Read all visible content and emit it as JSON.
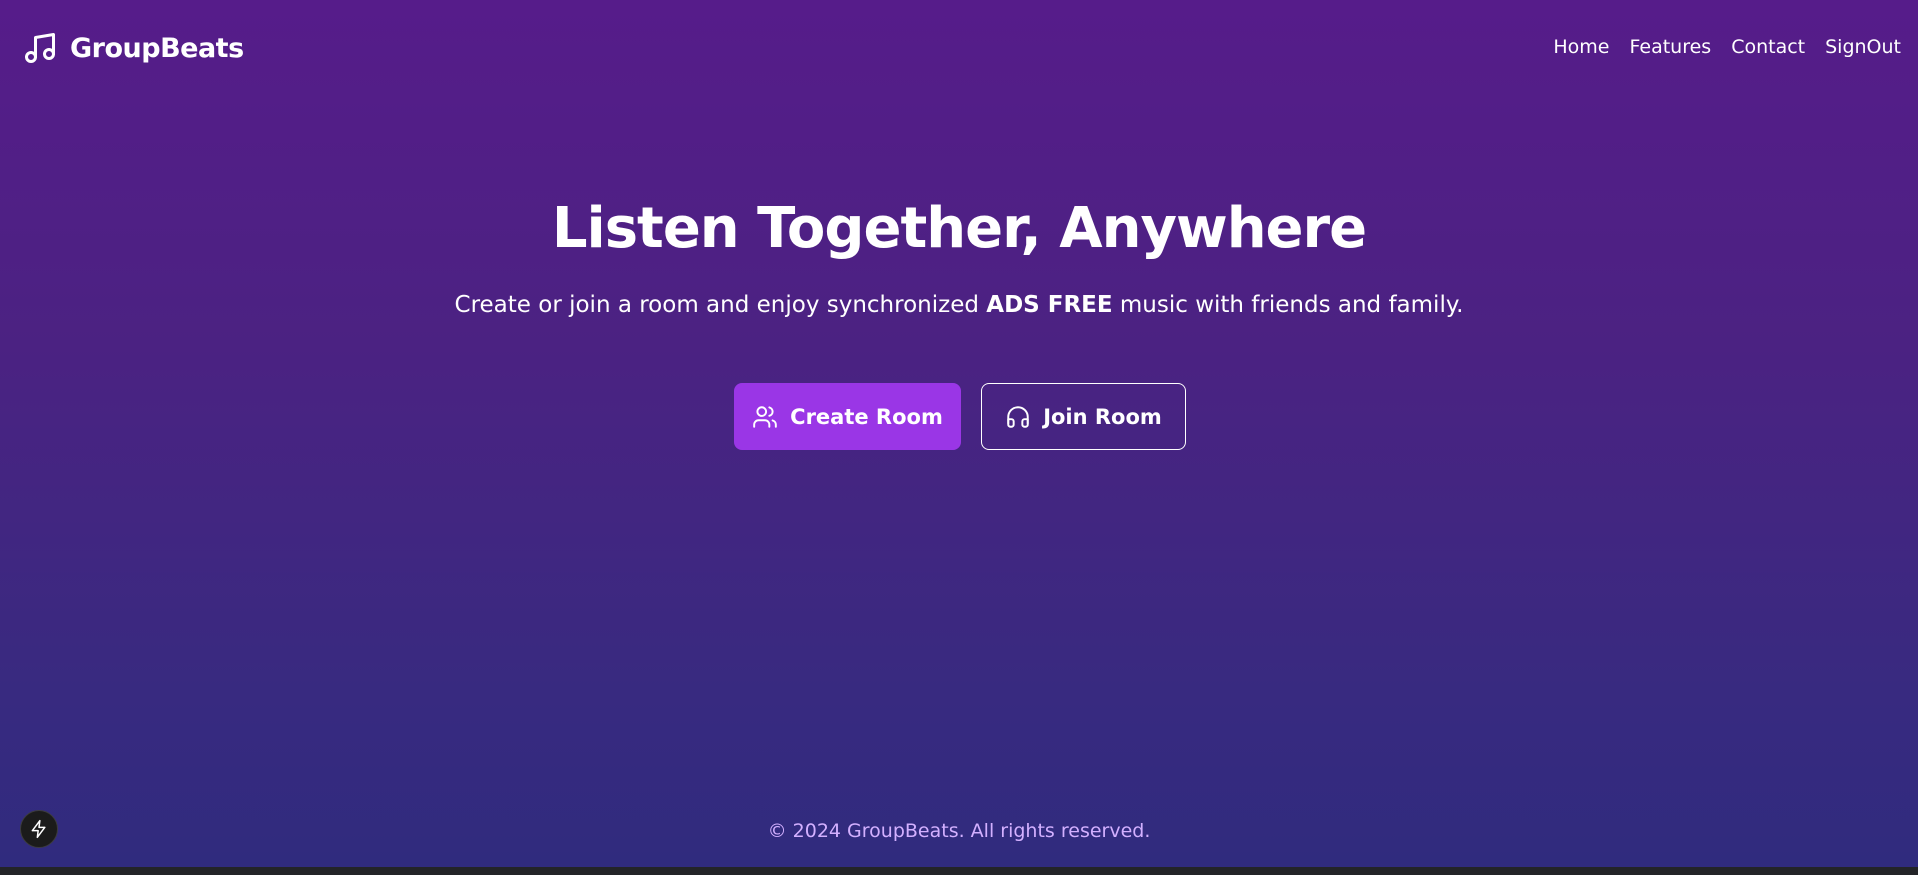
{
  "brand": {
    "name": "GroupBeats",
    "icon": "music-note-icon"
  },
  "nav": {
    "items": [
      "Home",
      "Features",
      "Contact",
      "SignOut"
    ]
  },
  "hero": {
    "title": "Listen Together, Anywhere",
    "subtitle_before": "Create or join a room and enjoy synchronized ",
    "subtitle_bold": "ADS FREE",
    "subtitle_after": " music with friends and family."
  },
  "actions": {
    "create_label": "Create Room",
    "create_icon": "users-icon",
    "join_label": "Join Room",
    "join_icon": "headphones-icon"
  },
  "footer": {
    "text": "© 2024 GroupBeats. All rights reserved."
  },
  "dev_badge": {
    "icon": "lightning-bolt-icon"
  },
  "colors": {
    "gradient_top": "#561c8a",
    "gradient_bottom": "#302b7e",
    "primary_button": "#9a36e6",
    "footer_text": "#d3b0ff"
  }
}
